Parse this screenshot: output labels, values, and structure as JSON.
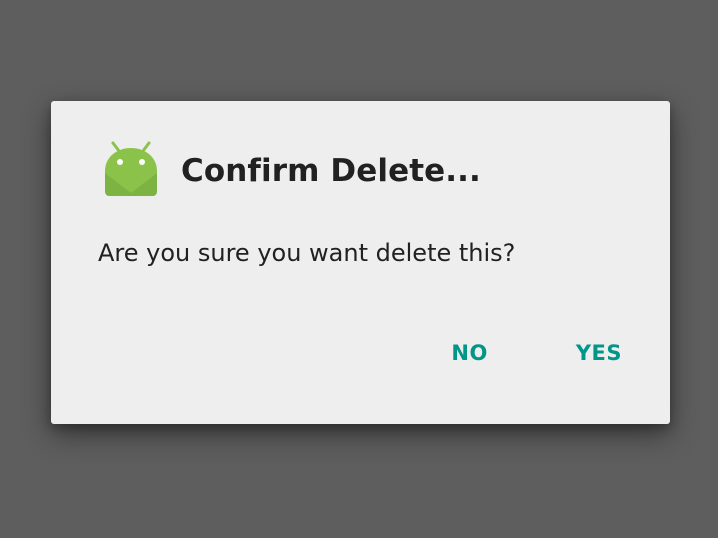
{
  "dialog": {
    "title": "Confirm Delete...",
    "message": "Are you sure you want delete this?",
    "icon": "android-app-icon",
    "buttons": {
      "negative_label": "NO",
      "positive_label": "YES"
    }
  },
  "colors": {
    "scrim": "#5e5e5e",
    "dialog_background": "#eeeeee",
    "title_text": "#212121",
    "button_text": "#009688",
    "android_green": "#8bc34a"
  }
}
